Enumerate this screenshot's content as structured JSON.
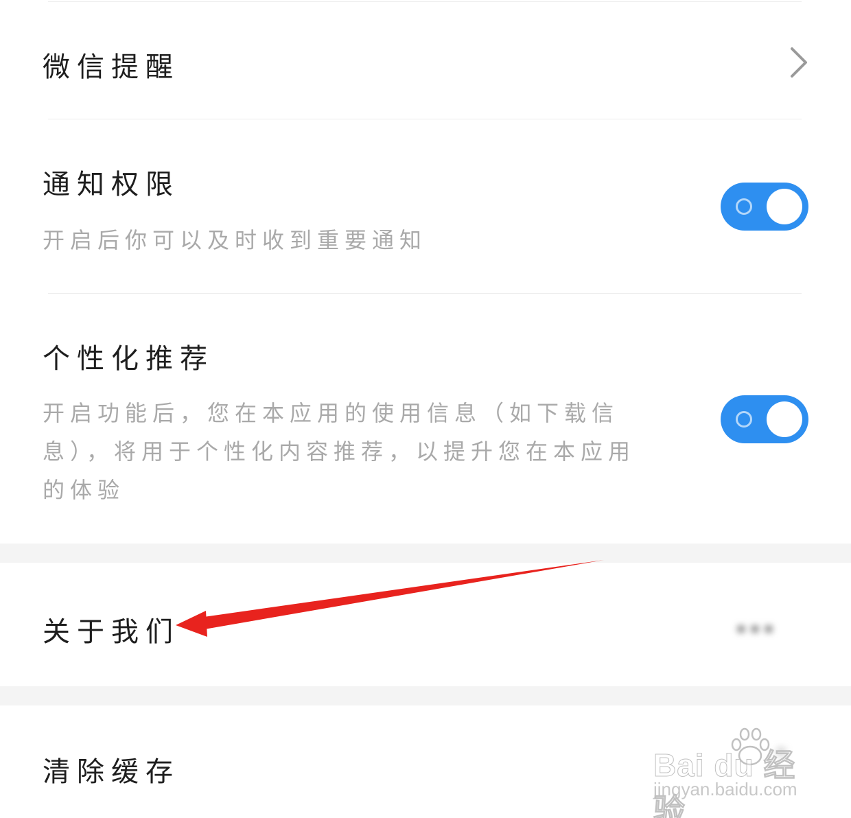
{
  "settings": {
    "wechat_reminder": {
      "title": "微信提醒"
    },
    "notification_permission": {
      "title": "通知权限",
      "description": "开启后你可以及时收到重要通知",
      "enabled": true
    },
    "personalized_recommendation": {
      "title": "个性化推荐",
      "description": "开启功能后，您在本应用的使用信息（如下载信息），将用于个性化内容推荐，以提升您在本应用的体验",
      "enabled": true
    },
    "about_us": {
      "title": "关于我们",
      "value": "•••"
    },
    "clear_cache": {
      "title": "清除缓存",
      "value": "•"
    }
  },
  "colors": {
    "toggle_on": "#2e8ff0",
    "arrow": "#e8231e",
    "section_gap": "#f4f4f4"
  },
  "watermark": {
    "brand": "Bai du 经验",
    "url": "jingyan.baidu.com"
  }
}
